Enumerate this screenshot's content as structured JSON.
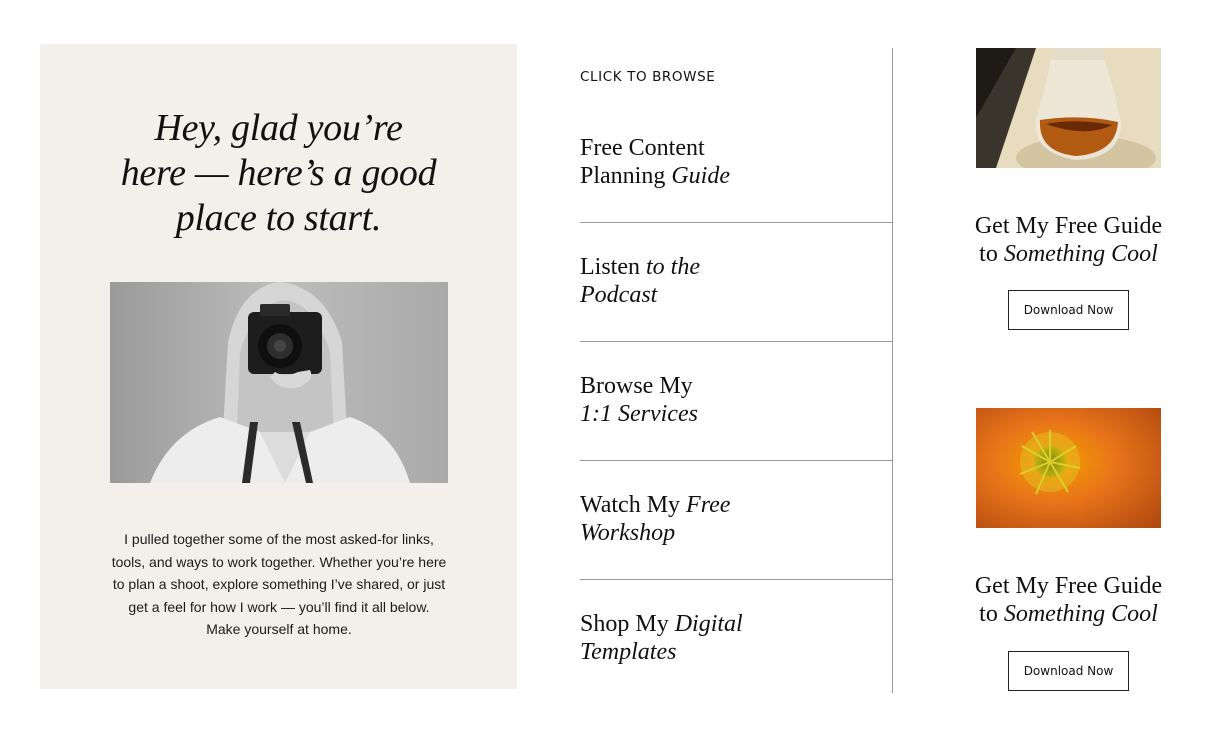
{
  "hero": {
    "line1": "Hey, glad you’re",
    "line2": "here — here’s a good",
    "line3": "place to start."
  },
  "intro": {
    "text": "I pulled together some of the most asked-for links, tools, and ways to work together. Whether you’re here to plan a shoot, explore something I’ve shared, or just get a feel for how I work — you’ll find it all below. Make yourself at home."
  },
  "browse": {
    "label": "CLICK TO BROWSE",
    "items": [
      {
        "a": "Free Content",
        "b": "Planning ",
        "c": "Guide"
      },
      {
        "a": "Listen ",
        "b": "to the",
        "c": "Podcast"
      },
      {
        "a": "Browse My",
        "b": "1:1 Services"
      },
      {
        "a": "Watch My ",
        "b": "Free",
        "c": "Workshop"
      },
      {
        "a": "Shop My ",
        "b": "Digital",
        "c": "Templates"
      }
    ]
  },
  "cards": [
    {
      "title_a": "Get My Free Guide",
      "title_b": "to ",
      "title_c": "Something Cool",
      "button": "Download Now",
      "image": "glass-jar-photo"
    },
    {
      "title_a": "Get My Free Guide",
      "title_b": "to ",
      "title_c": "Something Cool",
      "button": "Download Now",
      "image": "orange-poppy-photo"
    }
  ],
  "images": {
    "portrait": "woman-with-camera-photo"
  }
}
